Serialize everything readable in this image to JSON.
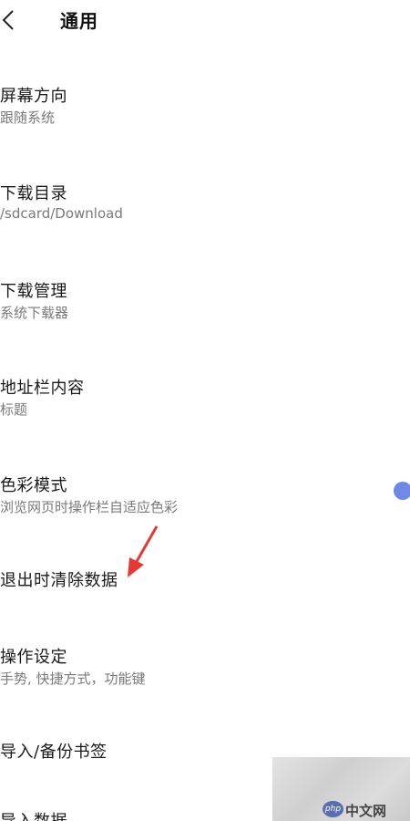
{
  "header": {
    "title": "通用"
  },
  "items": [
    {
      "title": "屏幕方向",
      "subtitle": "跟随系统"
    },
    {
      "title": "下载目录",
      "subtitle": "/sdcard/Download"
    },
    {
      "title": "下载管理",
      "subtitle": "系统下载器"
    },
    {
      "title": "地址栏内容",
      "subtitle": "标题"
    },
    {
      "title": "色彩模式",
      "subtitle": "浏览网页时操作栏自适应色彩"
    },
    {
      "title": "退出时清除数据"
    },
    {
      "title": "操作设定",
      "subtitle": "手势, 快捷方式，功能键"
    },
    {
      "title": "导入/备份书签"
    },
    {
      "title": "导入数据"
    }
  ],
  "icons": {
    "back": "chevron-left-icon",
    "annotation": "red-arrow-icon"
  },
  "colors": {
    "toggle": "#6f8ae6",
    "arrow": "#e53935"
  },
  "watermark": {
    "logo": "php",
    "text": "中文网"
  }
}
